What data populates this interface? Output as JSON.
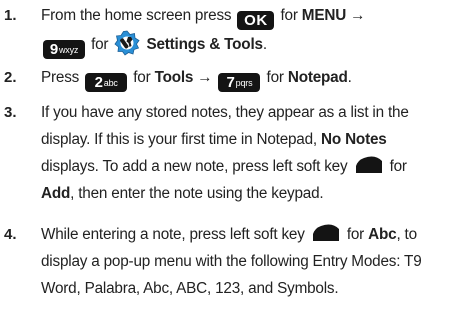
{
  "steps": [
    {
      "number": "1.",
      "p1": "From the home screen press",
      "ok_key": "OK",
      "p2": "for",
      "menu": "MENU",
      "arrow": "→",
      "key9_digit": "9",
      "key9_letters": "wxyz",
      "p3": "for",
      "settings_tools": "Settings & Tools",
      "p4": "."
    },
    {
      "number": "2.",
      "p1": "Press",
      "key2_digit": "2",
      "key2_letters": "abc",
      "p2": "for",
      "tools": "Tools",
      "arrow": "→",
      "key7_digit": "7",
      "key7_letters": "pqrs",
      "p3": "for",
      "notepad": "Notepad",
      "p4": "."
    },
    {
      "number": "3.",
      "line1": "If you have any stored notes, they appear as a list in the",
      "line2a": "display. If this is your first time in Notepad,",
      "no_notes": "No Notes",
      "line3a": "displays. To add a new note, press left soft key",
      "line3b": "for",
      "add": "Add",
      "line4b": ", then enter the note using the keypad."
    },
    {
      "number": "4.",
      "line1a": "While entering a note, press left soft key",
      "line1b": "for",
      "abc": "Abc",
      "line1c": ", to",
      "line2": "display a pop-up menu with the following Entry Modes: T9",
      "line3": "Word, Palabra, Abc, ABC, 123, and Symbols."
    }
  ]
}
